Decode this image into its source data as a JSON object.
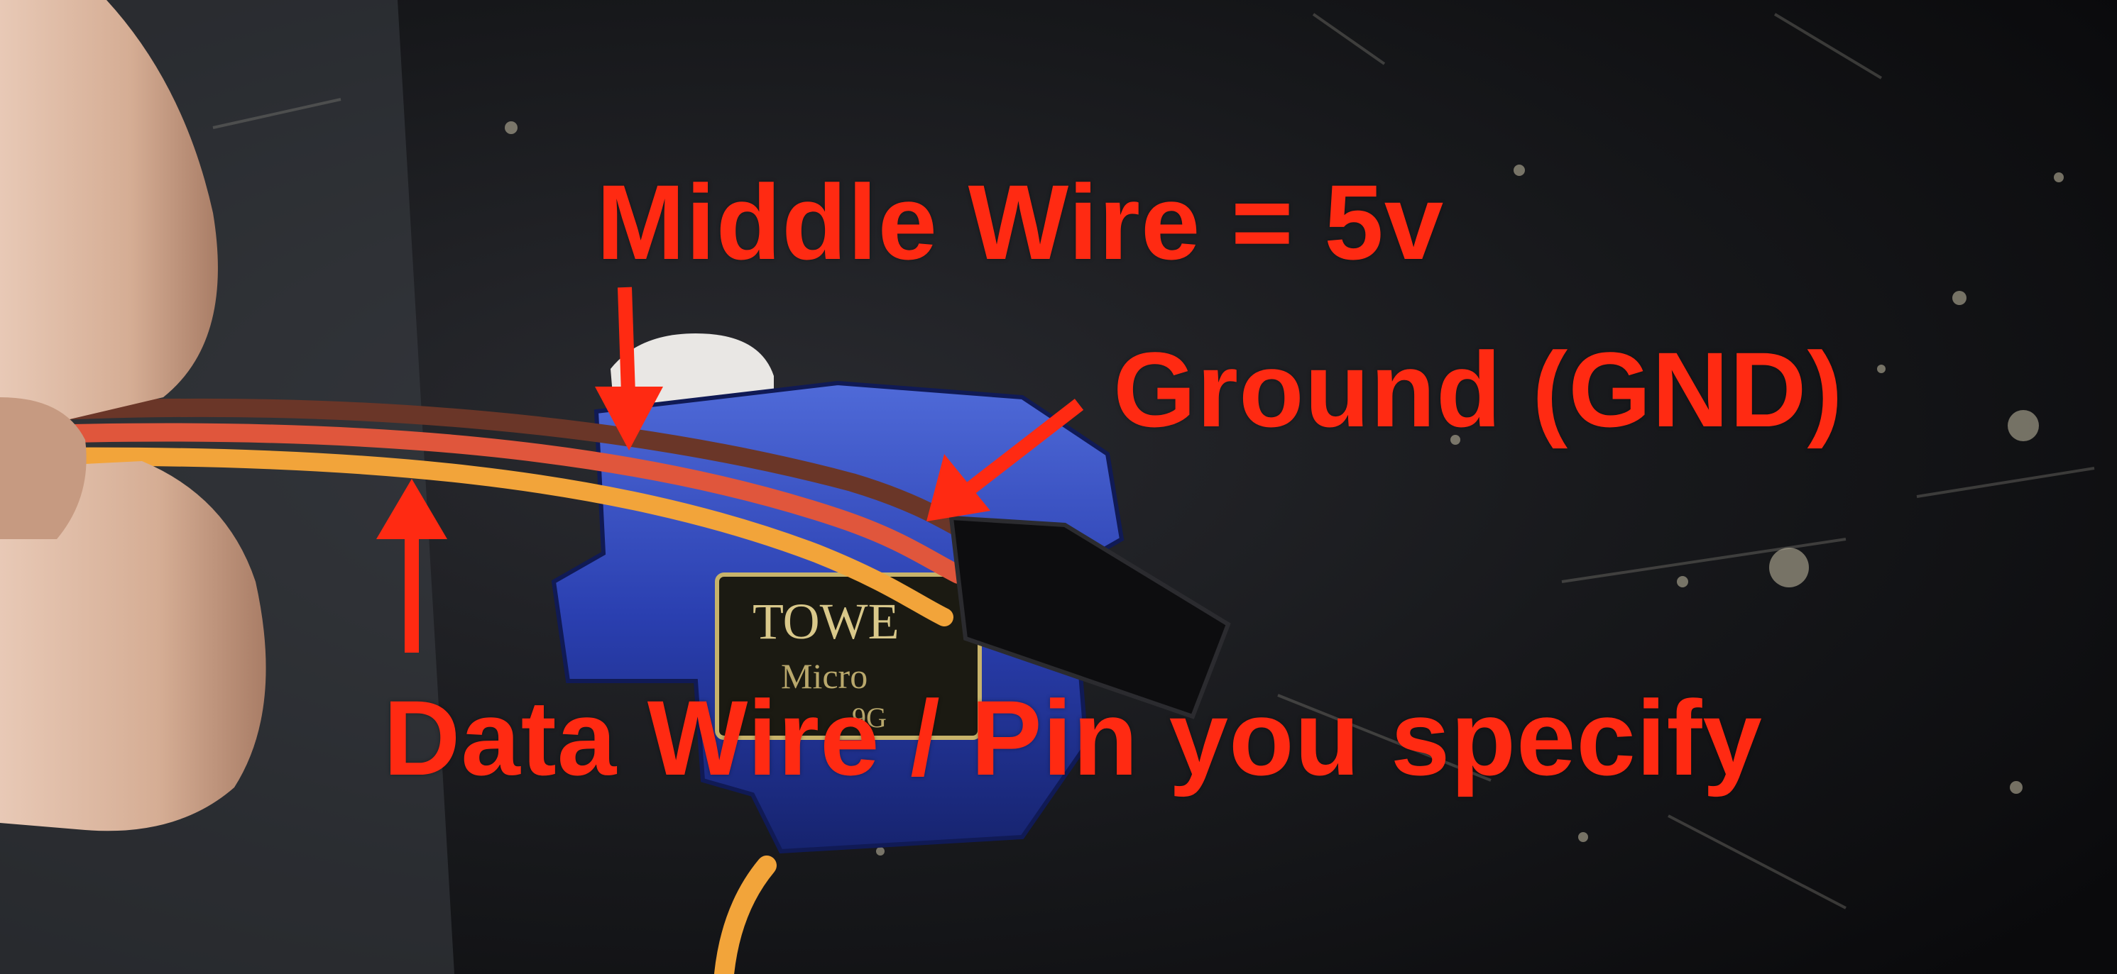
{
  "annotations": {
    "middle_wire": "Middle Wire = 5v",
    "ground": "Ground (GND)",
    "data_wire": "Data Wire / Pin you specify"
  },
  "colors": {
    "annotation": "#ff2a12",
    "background": "#111113",
    "servo_body": "#2a3fb0",
    "wire_brown": "#6a3628",
    "wire_red": "#e0563c",
    "wire_orange": "#f2a43a",
    "connector": "#0d0d0f",
    "finger": "#d8b49e"
  },
  "servo_label": {
    "brand": "TOWE",
    "line2": "Micro",
    "line3": "9G"
  }
}
